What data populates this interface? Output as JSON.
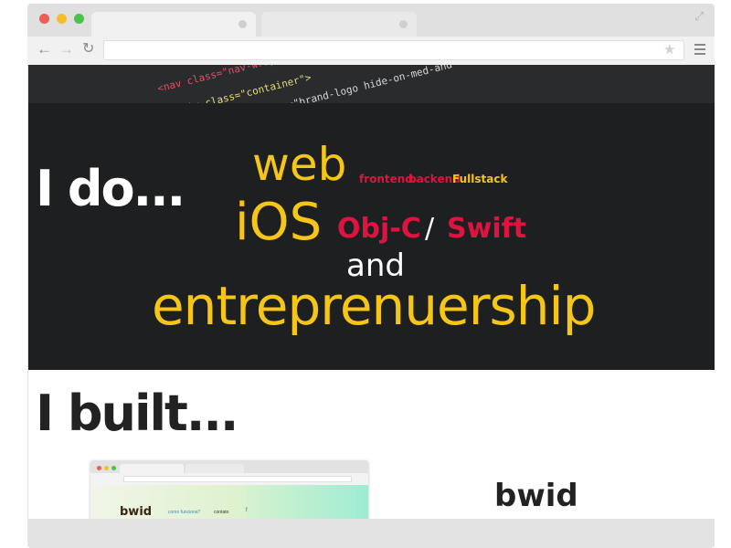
{
  "browser": {
    "dots": [
      "close",
      "minimize",
      "maximize"
    ],
    "colors": {
      "red": "#ee5e58",
      "yellow": "#f1be32",
      "green": "#4ac24b"
    },
    "icons": [
      "back-arrow-icon",
      "forward-arrow-icon",
      "reload-icon",
      "star-icon",
      "menu-icon",
      "expand-icon"
    ],
    "glyphs": {
      "back": "←",
      "forward": "→",
      "reload": "↻",
      "star": "★",
      "expand": "⤢"
    }
  },
  "code_banner": {
    "lines": [
      "<nav class=\"nav-wrapper",
      "<div class=\"container\">",
      "class=\"brand-logo hide-on-med-and"
    ]
  },
  "hero": {
    "title": "I do...",
    "web": "web",
    "frontend": "frontend",
    "backend": "backend",
    "fullstack": "Fullstack",
    "ios": "iOS",
    "objc": "Obj-C",
    "slash": "/",
    "swift": "Swift",
    "and": "and",
    "entrepreneurship": "entreprenuership",
    "colors": {
      "accent_yellow": "#f5c518",
      "accent_red": "#e0123f",
      "background": "#1e1f21"
    }
  },
  "built": {
    "title": "I built...",
    "project_name": "bwid",
    "thumbnail": {
      "logo": "bwid",
      "nav_item_1": "como funciona?",
      "nav_item_2": "contato",
      "icons": "  f "
    }
  }
}
